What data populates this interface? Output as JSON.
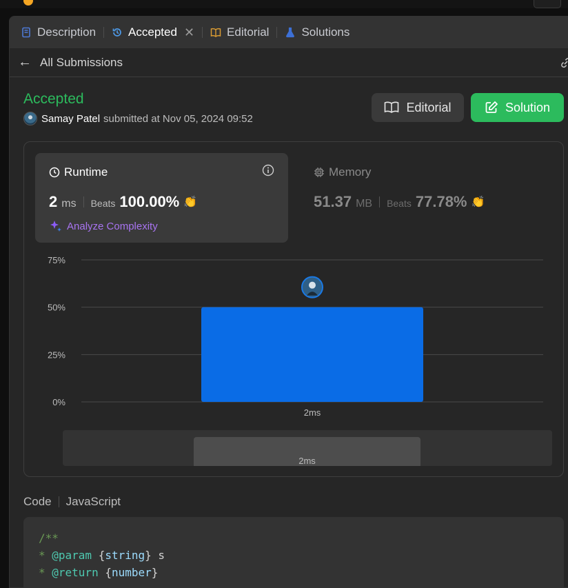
{
  "tabs": [
    {
      "label": "Description",
      "icon": "description-icon"
    },
    {
      "label": "Accepted",
      "icon": "history-icon"
    },
    {
      "label": "Editorial",
      "icon": "book-icon"
    },
    {
      "label": "Solutions",
      "icon": "flask-icon"
    }
  ],
  "subbar": {
    "back_label": "All Submissions"
  },
  "submission": {
    "status": "Accepted",
    "author": "Samay Patel",
    "submitted_text": "submitted at Nov 05, 2024 09:52"
  },
  "actions": {
    "editorial": "Editorial",
    "solution": "Solution"
  },
  "runtime": {
    "title": "Runtime",
    "value": "2",
    "unit": "ms",
    "beats_label": "Beats",
    "beats_pct": "100.00%",
    "analyze_label": "Analyze Complexity"
  },
  "memory": {
    "title": "Memory",
    "value": "51.37",
    "unit": "MB",
    "beats_label": "Beats",
    "beats_pct": "77.78%"
  },
  "colors": {
    "accent_green": "#2cbb5d",
    "bar_blue": "#0a6ce6",
    "purple": "#a874f0"
  },
  "chart_data": {
    "type": "bar",
    "categories": [
      "2ms"
    ],
    "values": [
      50
    ],
    "yticks": [
      "75%",
      "50%",
      "25%",
      "0%"
    ],
    "ylim": [
      0,
      75
    ],
    "grid": true
  },
  "minimap": {
    "label": "2ms"
  },
  "code": {
    "header": "Code",
    "language": "JavaScript",
    "lines": [
      "/**",
      " * @param {string} s",
      " * @return {number}"
    ]
  }
}
